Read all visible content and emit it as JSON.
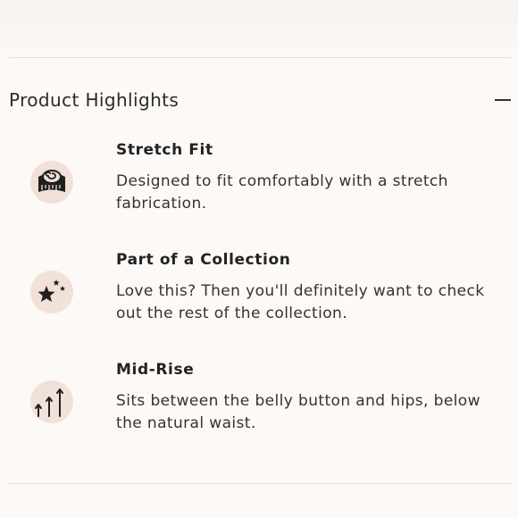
{
  "section": {
    "title": "Product Highlights",
    "collapse_icon": "minus-icon"
  },
  "highlights": [
    {
      "title": "Stretch Fit",
      "description": "Designed to fit comfortably with a stretch fabrication.",
      "icon": "measuring-tape-icon"
    },
    {
      "title": "Part of a Collection",
      "description": "Love this? Then you'll definitely want to check out the rest of the collection.",
      "icon": "stars-icon"
    },
    {
      "title": "Mid-Rise",
      "description": "Sits between the belly button and hips, below the natural waist.",
      "icon": "rising-arrows-icon"
    }
  ],
  "colors": {
    "background": "#fcf9f7",
    "icon_circle": "#f2e1d8",
    "divider": "#e2dedb",
    "text": "#222222"
  }
}
